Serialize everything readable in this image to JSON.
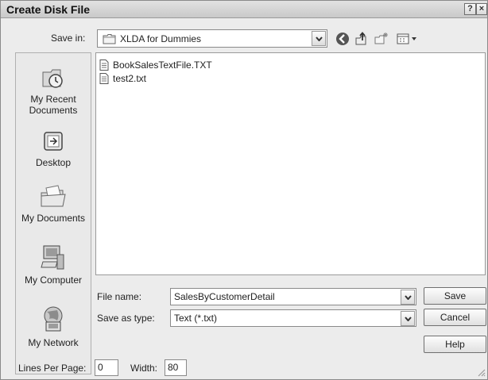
{
  "window": {
    "title": "Create Disk File",
    "help_glyph": "?",
    "close_glyph": "×"
  },
  "save_in": {
    "label": "Save in:",
    "value": "XLDA for Dummies"
  },
  "toolbar": {
    "icons": [
      "back-icon",
      "up-folder-icon",
      "new-folder-icon",
      "views-menu-icon"
    ]
  },
  "places": [
    {
      "label": "My Recent Documents",
      "icon": "recent-documents-icon"
    },
    {
      "label": "Desktop",
      "icon": "desktop-icon"
    },
    {
      "label": "My Documents",
      "icon": "my-documents-icon"
    },
    {
      "label": "My Computer",
      "icon": "my-computer-icon"
    },
    {
      "label": "My Network",
      "icon": "my-network-icon"
    }
  ],
  "files": [
    {
      "name": "BookSalesTextFile.TXT",
      "icon": "text-file-icon"
    },
    {
      "name": "test2.txt",
      "icon": "text-file-icon"
    }
  ],
  "file_name": {
    "label": "File name:",
    "value": "SalesByCustomerDetail"
  },
  "save_as_type": {
    "label": "Save as type:",
    "value": "Text (*.txt)"
  },
  "buttons": {
    "save": "Save",
    "cancel": "Cancel",
    "help": "Help"
  },
  "lines_per_page": {
    "label": "Lines Per Page:",
    "value": "0"
  },
  "width": {
    "label": "Width:",
    "value": "80"
  }
}
